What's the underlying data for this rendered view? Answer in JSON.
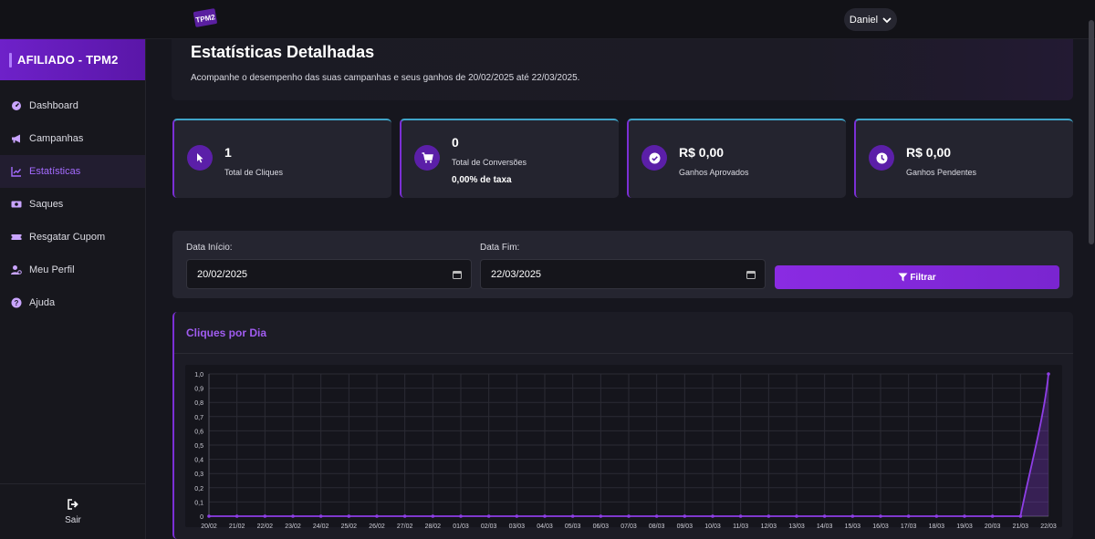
{
  "topbar": {
    "logo_text": "TPM2",
    "user_name": "Daniel"
  },
  "sidebar": {
    "brand": "AFILIADO - TPM2",
    "items": [
      {
        "label": "Dashboard",
        "icon": "gauge-icon"
      },
      {
        "label": "Campanhas",
        "icon": "megaphone-icon"
      },
      {
        "label": "Estatísticas",
        "icon": "chart-line-icon"
      },
      {
        "label": "Saques",
        "icon": "money-icon"
      },
      {
        "label": "Resgatar Cupom",
        "icon": "ticket-icon"
      },
      {
        "label": "Meu Perfil",
        "icon": "user-gear-icon"
      },
      {
        "label": "Ajuda",
        "icon": "question-icon"
      }
    ],
    "active_index": 2,
    "logout_label": "Sair"
  },
  "header": {
    "title": "Estatísticas Detalhadas",
    "subtitle": "Acompanhe o desempenho das suas campanhas e seus ganhos de 20/02/2025 até 22/03/2025."
  },
  "stats": [
    {
      "value": "1",
      "label": "Total de Cliques",
      "icon": "cursor-icon"
    },
    {
      "value": "0",
      "label": "Total de Conversões",
      "extra": "0,00% de taxa",
      "icon": "cart-icon"
    },
    {
      "value": "R$ 0,00",
      "label": "Ganhos Aprovados",
      "icon": "check-circle-icon"
    },
    {
      "value": "R$ 0,00",
      "label": "Ganhos Pendentes",
      "icon": "clock-icon"
    }
  ],
  "filter": {
    "start_label": "Data Início:",
    "start_value": "20/02/2025",
    "end_label": "Data Fim:",
    "end_value": "22/03/2025",
    "button_label": "Filtrar"
  },
  "colors": {
    "accent": "#8a2be2",
    "line": "#8e3ee6"
  },
  "chart_data": {
    "type": "line",
    "title": "Cliques por Dia",
    "x": [
      "20/02",
      "21/02",
      "22/02",
      "23/02",
      "24/02",
      "25/02",
      "26/02",
      "27/02",
      "28/02",
      "01/03",
      "02/03",
      "03/03",
      "04/03",
      "05/03",
      "06/03",
      "07/03",
      "08/03",
      "09/03",
      "10/03",
      "11/03",
      "12/03",
      "13/03",
      "14/03",
      "15/03",
      "16/03",
      "17/03",
      "18/03",
      "19/03",
      "20/03",
      "21/03",
      "22/03"
    ],
    "values": [
      0,
      0,
      0,
      0,
      0,
      0,
      0,
      0,
      0,
      0,
      0,
      0,
      0,
      0,
      0,
      0,
      0,
      0,
      0,
      0,
      0,
      0,
      0,
      0,
      0,
      0,
      0,
      0,
      0,
      0,
      1
    ],
    "ylim": [
      0,
      1
    ],
    "yticks": [
      "0",
      "0,1",
      "0,2",
      "0,3",
      "0,4",
      "0,5",
      "0,6",
      "0,7",
      "0,8",
      "0,9",
      "1,0"
    ],
    "grid": true,
    "fill": true
  }
}
